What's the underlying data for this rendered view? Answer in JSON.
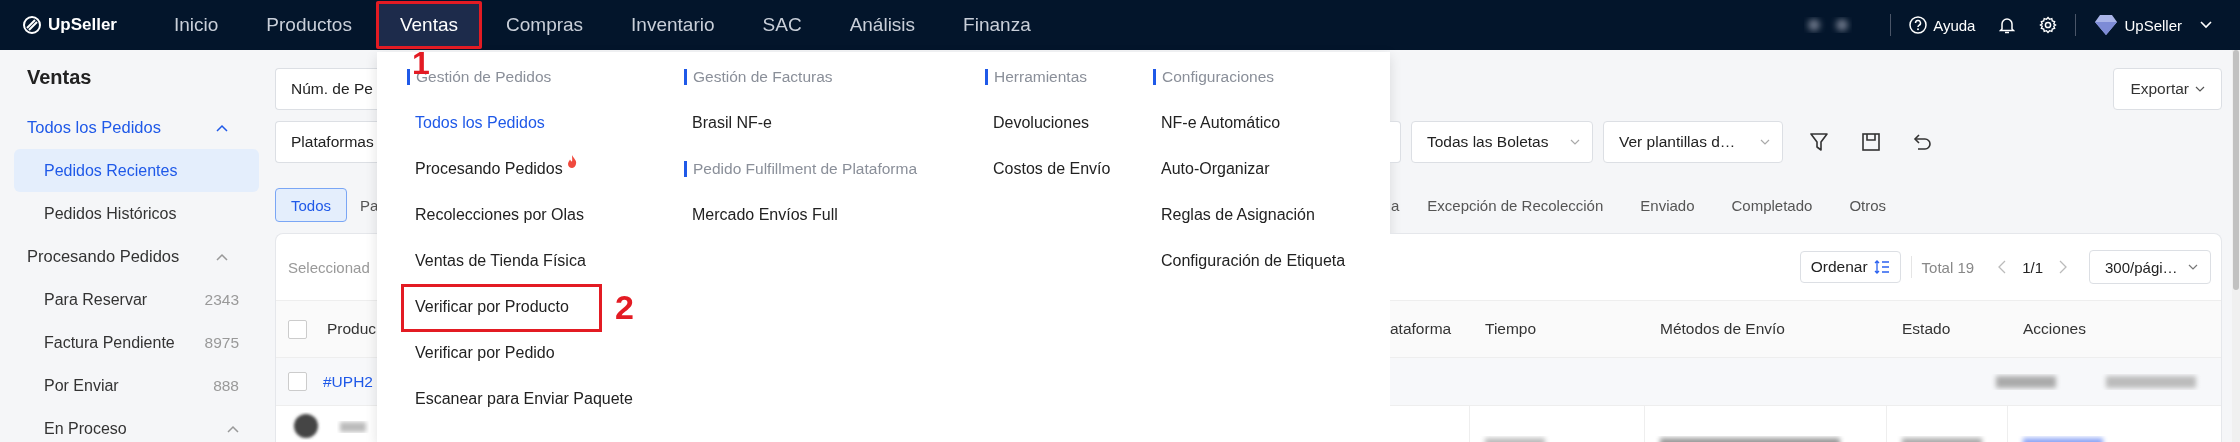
{
  "nav": {
    "logo": "UpSeller",
    "items": [
      {
        "label": "Inicio",
        "selected": false
      },
      {
        "label": "Productos",
        "selected": false
      },
      {
        "label": "Ventas",
        "selected": true,
        "callout": "1"
      },
      {
        "label": "Compras",
        "selected": false
      },
      {
        "label": "Inventario",
        "selected": false
      },
      {
        "label": "SAC",
        "selected": false
      },
      {
        "label": "Análisis",
        "selected": false
      },
      {
        "label": "Finanza",
        "selected": false
      }
    ],
    "help": "Ayuda",
    "account": "UpSeller"
  },
  "sidebar": {
    "title": "Ventas",
    "groups": [
      {
        "label": "Todos los Pedidos",
        "active": true,
        "expanded": true,
        "children": [
          {
            "label": "Pedidos Recientes",
            "selected": true
          },
          {
            "label": "Pedidos Históricos",
            "selected": false
          }
        ]
      },
      {
        "label": "Procesando Pedidos",
        "active": false,
        "expanded": true,
        "children": [
          {
            "label": "Para Reservar",
            "count": "2343",
            "selected": false
          },
          {
            "label": "Factura Pendiente",
            "count": "8975",
            "selected": false
          },
          {
            "label": "Por Enviar",
            "count": "888",
            "selected": false
          },
          {
            "label": "En Proceso",
            "expanded": true,
            "selected": false
          }
        ]
      }
    ]
  },
  "sales_menu": {
    "columns": [
      {
        "sections": [
          {
            "heading": "Gestión de Pedidos",
            "items": [
              {
                "label": "Todos los Pedidos",
                "selected": true,
                "hot": false
              },
              {
                "label": "Procesando Pedidos",
                "selected": false,
                "hot": true
              },
              {
                "label": "Recolecciones por Olas",
                "selected": false,
                "hot": false
              },
              {
                "label": "Ventas de Tienda Física",
                "selected": false,
                "hot": false
              },
              {
                "label": "Verificar por Producto",
                "selected": false,
                "hot": false,
                "callout": "2"
              },
              {
                "label": "Verificar por Pedido",
                "selected": false,
                "hot": false
              },
              {
                "label": "Escanear para Enviar Paquete",
                "selected": false,
                "hot": false
              }
            ]
          }
        ]
      },
      {
        "sections": [
          {
            "heading": "Gestión de Facturas",
            "items": [
              {
                "label": "Brasil NF-e",
                "selected": false,
                "hot": false
              }
            ]
          },
          {
            "heading": "Pedido Fulfillment de Plataforma",
            "items": [
              {
                "label": "Mercado Envíos Full",
                "selected": false,
                "hot": false
              }
            ]
          }
        ]
      },
      {
        "sections": [
          {
            "heading": "Herramientas",
            "items": [
              {
                "label": "Devoluciones",
                "selected": false,
                "hot": false
              },
              {
                "label": "Costos de Envío",
                "selected": false,
                "hot": false
              }
            ]
          }
        ]
      },
      {
        "sections": [
          {
            "heading": "Configuraciones",
            "items": [
              {
                "label": "NF-e Automático",
                "selected": false,
                "hot": false
              },
              {
                "label": "Auto-Organizar",
                "selected": false,
                "hot": false
              },
              {
                "label": "Reglas de Asignación",
                "selected": false,
                "hot": false
              },
              {
                "label": "Configuración de Etiqueta",
                "selected": false,
                "hot": false
              }
            ]
          }
        ]
      }
    ]
  },
  "filters": {
    "search_type": "Núm. de Pe",
    "platforms": "Plataformas",
    "boletas": "Todas las Boletas",
    "templates": "Ver plantillas d…"
  },
  "export": "Exportar",
  "status_tabs": [
    {
      "label": "Todos",
      "selected": true
    },
    {
      "label": "Pa",
      "selected": false
    },
    {
      "label": "a",
      "selected": false
    },
    {
      "label": "Excepción de Recolección",
      "selected": false
    },
    {
      "label": "Enviado",
      "selected": false
    },
    {
      "label": "Completado",
      "selected": false
    },
    {
      "label": "Otros",
      "selected": false
    }
  ],
  "table": {
    "selection_hint": "Seleccionad",
    "sort": "Ordenar",
    "total": "Total 19",
    "page": "1/1",
    "page_size": "300/pági…",
    "header_checked": false,
    "columns": [
      "Produc",
      "ataforma",
      "Tiempo",
      "Métodos de Envío",
      "Estado",
      "Acciones"
    ],
    "rows": [
      {
        "order": "#UPH2",
        "checked": false
      }
    ]
  }
}
